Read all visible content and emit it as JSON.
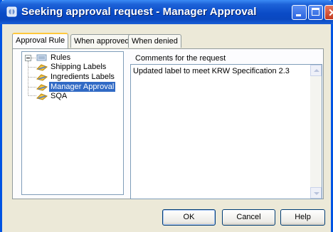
{
  "window": {
    "title": "Seeking approval request - Manager Approval",
    "icon": "app-icon",
    "controls": [
      "minimize-icon",
      "maximize-icon",
      "close-icon"
    ],
    "close_glyph": "✕"
  },
  "tabs": [
    {
      "label": "Approval Rule",
      "active": true
    },
    {
      "label": "When approved",
      "active": false
    },
    {
      "label": "When denied",
      "active": false
    }
  ],
  "tree": {
    "root": {
      "label": "Rules",
      "expanded": true,
      "icon": "rules-folder-icon"
    },
    "children": [
      {
        "label": "Shipping Labels",
        "icon": "rule-icon",
        "selected": false
      },
      {
        "label": "Ingredients Labels",
        "icon": "rule-icon",
        "selected": false
      },
      {
        "label": "Manager Approval",
        "icon": "rule-icon",
        "selected": true
      },
      {
        "label": "SQA",
        "icon": "rule-icon",
        "selected": false
      }
    ]
  },
  "comments": {
    "label": "Comments for the request",
    "value": "Updated label to meet KRW Specification 2.3"
  },
  "buttons": {
    "ok": "OK",
    "cancel": "Cancel",
    "help": "Help"
  },
  "colors": {
    "titlebar": "#0a4bc7",
    "selection": "#316ac5",
    "window_bg": "#ece9d8"
  }
}
